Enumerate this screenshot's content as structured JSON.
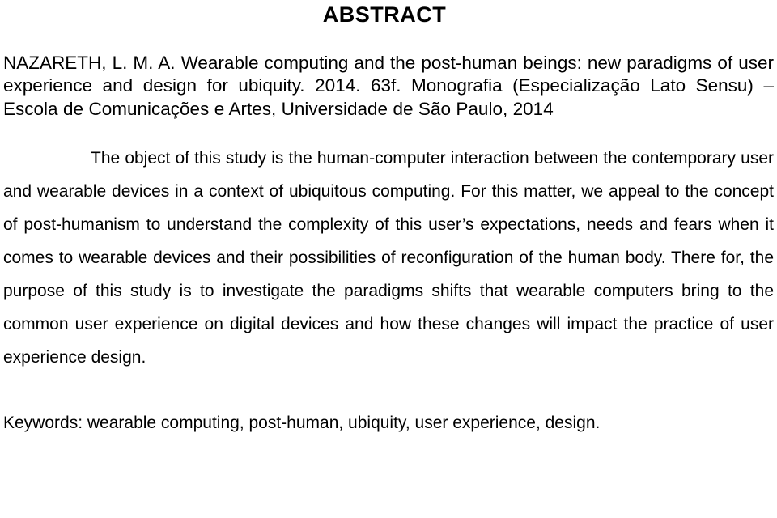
{
  "document": {
    "title": "ABSTRACT",
    "citation": "NAZARETH, L. M. A. Wearable computing and the post-human beings: new paradigms of user experience and design for ubiquity. 2014. 63f. Monografia (Especialização Lato Sensu) – Escola de Comunicações e Artes, Universidade de São Paulo, 2014",
    "abstract_text": "The object of this study is the human-computer interaction between the contemporary user and wearable devices in a context of ubiquitous computing. For this matter, we appeal to the concept of post-humanism to understand the complexity of this user’s expectations, needs and fears when it comes to wearable devices and their possibilities of reconfiguration of the human body. There for, the purpose of this study is to investigate the paradigms shifts that wearable computers bring to the common user experience on digital devices and how these changes will impact the practice of user experience design.",
    "keywords": "Keywords: wearable computing, post-human, ubiquity, user experience, design."
  }
}
